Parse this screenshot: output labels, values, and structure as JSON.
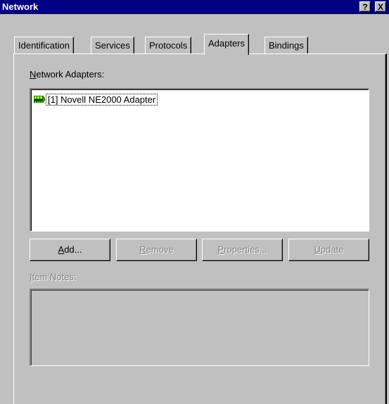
{
  "window": {
    "title": "Network",
    "help_label": "?",
    "close_label": "X"
  },
  "tabs": [
    {
      "label": "Identification",
      "active": false
    },
    {
      "label": "Services",
      "active": false
    },
    {
      "label": "Protocols",
      "active": false
    },
    {
      "label": "Adapters",
      "active": true
    },
    {
      "label": "Bindings",
      "active": false
    }
  ],
  "adapters": {
    "label_mnemonic": "N",
    "label_rest": "etwork Adapters:",
    "items": [
      {
        "label": "[1] Novell NE2000 Adapter",
        "icon": "network-adapter-icon"
      }
    ]
  },
  "buttons": [
    {
      "mnemonic": "A",
      "rest": "dd...",
      "enabled": true
    },
    {
      "mnemonic": "R",
      "rest": "emove",
      "enabled": false
    },
    {
      "mnemonic": "P",
      "rest": "roperties...",
      "enabled": false
    },
    {
      "mnemonic": "U",
      "rest": "pdate",
      "enabled": false
    }
  ],
  "notes": {
    "label_mnemonic": "I",
    "label_rest": "tem Notes:",
    "enabled": false,
    "value": ""
  },
  "colors": {
    "titlebar": "#000080",
    "face": "#c0c0c0",
    "disabled_text": "#808080"
  }
}
